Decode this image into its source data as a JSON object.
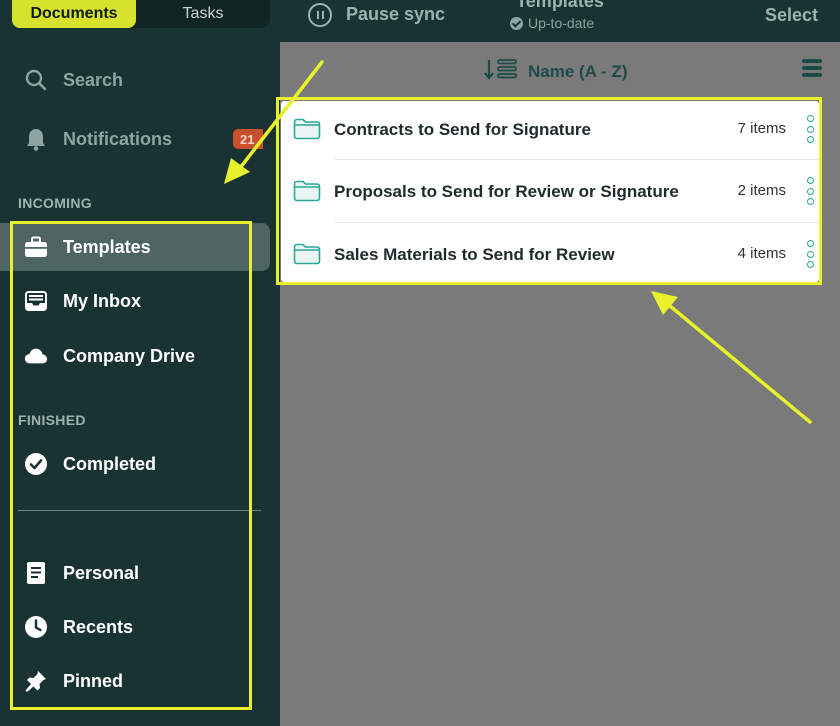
{
  "sidebar": {
    "segmented": {
      "documents": "Documents",
      "tasks": "Tasks"
    },
    "search": "Search",
    "notifications": {
      "label": "Notifications",
      "badge": "21"
    },
    "incoming_header": "INCOMING",
    "templates": "Templates",
    "my_inbox": "My Inbox",
    "company_drive": "Company Drive",
    "finished_header": "FINISHED",
    "completed": "Completed",
    "personal": "Personal",
    "recents": "Recents",
    "pinned": "Pinned"
  },
  "topbar": {
    "pause_sync": "Pause sync",
    "title": "Templates",
    "status": "Up-to-date",
    "select": "Select"
  },
  "sort": {
    "label": "Name (A - Z)"
  },
  "templates": [
    {
      "name": "Contracts to Send for Signature",
      "count": "7 items"
    },
    {
      "name": "Proposals to Send for Review or Signature",
      "count": "2 items"
    },
    {
      "name": "Sales Materials to Send for Review",
      "count": "4 items"
    }
  ],
  "colors": {
    "sidebar_bg": "#183331",
    "accent_yellow": "#d6e22c",
    "highlight": "#e8f12a",
    "teal_icon": "#2aa79b",
    "content_bg": "#7a7a7a"
  }
}
